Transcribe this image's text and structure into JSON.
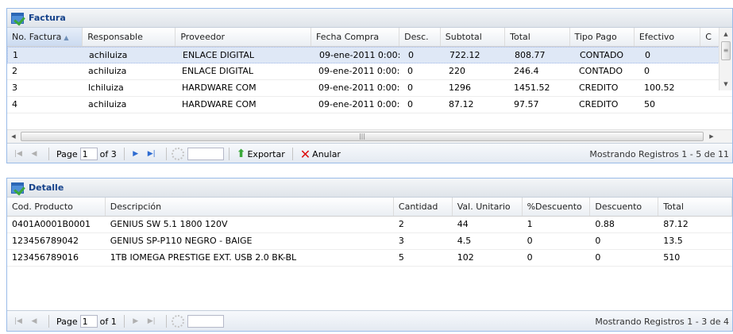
{
  "factura": {
    "title": "Factura",
    "columns": [
      "No. Factura",
      "Responsable",
      "Proveedor",
      "Fecha Compra",
      "Desc.",
      "Subtotal",
      "Total",
      "Tipo Pago",
      "Efectivo",
      "C"
    ],
    "rows": [
      [
        "1",
        "achiluiza",
        "ENLACE DIGITAL",
        "09-ene-2011 0:00:",
        "0",
        "722.12",
        "808.77",
        "CONTADO",
        "0"
      ],
      [
        "2",
        "achiluiza",
        "ENLACE DIGITAL",
        "09-ene-2011 0:00:",
        "0",
        "220",
        "246.4",
        "CONTADO",
        "0"
      ],
      [
        "3",
        "lchiluiza",
        "HARDWARE COM",
        "09-ene-2011 0:00:",
        "0",
        "1296",
        "1451.52",
        "CREDITO",
        "100.52"
      ],
      [
        "4",
        "achiluiza",
        "HARDWARE COM",
        "09-ene-2011 0:00:",
        "0",
        "87.12",
        "97.57",
        "CREDITO",
        "50"
      ]
    ],
    "toolbar": {
      "page_label": "Page",
      "page_value": "1",
      "of_label": "of 3",
      "export_label": "Exportar",
      "cancel_label": "Anular",
      "status": "Mostrando Registros 1 - 5 de 11"
    }
  },
  "detalle": {
    "title": "Detalle",
    "columns": [
      "Cod. Producto",
      "Descripción",
      "Cantidad",
      "Val. Unitario",
      "%Descuento",
      "Descuento",
      "Total"
    ],
    "rows": [
      [
        "0401A0001B0001",
        "GENIUS SW 5.1 1800 120V",
        "2",
        "44",
        "1",
        "0.88",
        "87.12"
      ],
      [
        "123456789042",
        "GENIUS SP-P110 NEGRO - BAIGE",
        "3",
        "4.5",
        "0",
        "0",
        "13.5"
      ],
      [
        "123456789016",
        "1TB IOMEGA PRESTIGE EXT. USB 2.0 BK-BL",
        "5",
        "102",
        "0",
        "0",
        "510"
      ]
    ],
    "toolbar": {
      "page_label": "Page",
      "page_value": "1",
      "of_label": "of 1",
      "status": "Mostrando Registros 1 - 3 de 4"
    }
  },
  "colors": {
    "header_text": "#15428b",
    "selected_row": "#dfe8f6",
    "panel_border": "#99bbe8"
  }
}
